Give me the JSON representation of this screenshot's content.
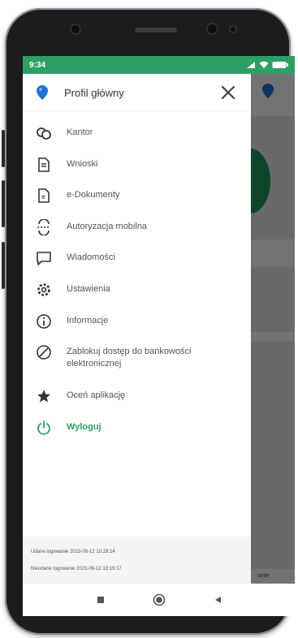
{
  "status_bar": {
    "time": "9:34",
    "signal_icon": "signal-icon",
    "wifi_icon": "wifi-icon",
    "battery_icon": "battery-icon"
  },
  "drawer": {
    "header": {
      "label": "Profil główny",
      "pin_icon": "location-pin-icon",
      "close_icon": "close-icon"
    },
    "menu": [
      {
        "label": "Kantor",
        "icon": "currency-exchange-icon"
      },
      {
        "label": "Wnioski",
        "icon": "document-icon"
      },
      {
        "label": "e-Dokumenty",
        "icon": "e-document-icon"
      },
      {
        "label": "Autoryzacja mobilna",
        "icon": "mobile-authorization-icon"
      },
      {
        "label": "Wiadomości",
        "icon": "message-icon"
      },
      {
        "label": "Ustawienia",
        "icon": "gear-icon"
      },
      {
        "label": "Informacje",
        "icon": "info-icon"
      },
      {
        "label": "Zablokuj dostęp do bankowości elektronicznej",
        "icon": "block-icon"
      },
      {
        "label": "Oceń aplikację",
        "icon": "star-icon"
      },
      {
        "label": "Wyloguj",
        "icon": "power-icon"
      }
    ],
    "footer": {
      "successful_login": "Udane logowanie 2023-06-12 10:29:14",
      "failed_login": "Nieudane logowanie 2023-06-12 10:19:17"
    }
  },
  "background_app": {
    "bottom_label": "ianie"
  },
  "nav_bar": {
    "recents_icon": "square-icon",
    "home_icon": "circle-icon",
    "back_icon": "triangle-back-icon"
  },
  "colors": {
    "accent": "#2e9f62",
    "pin_blue": "#1e73d8",
    "overlay": "#000000"
  }
}
